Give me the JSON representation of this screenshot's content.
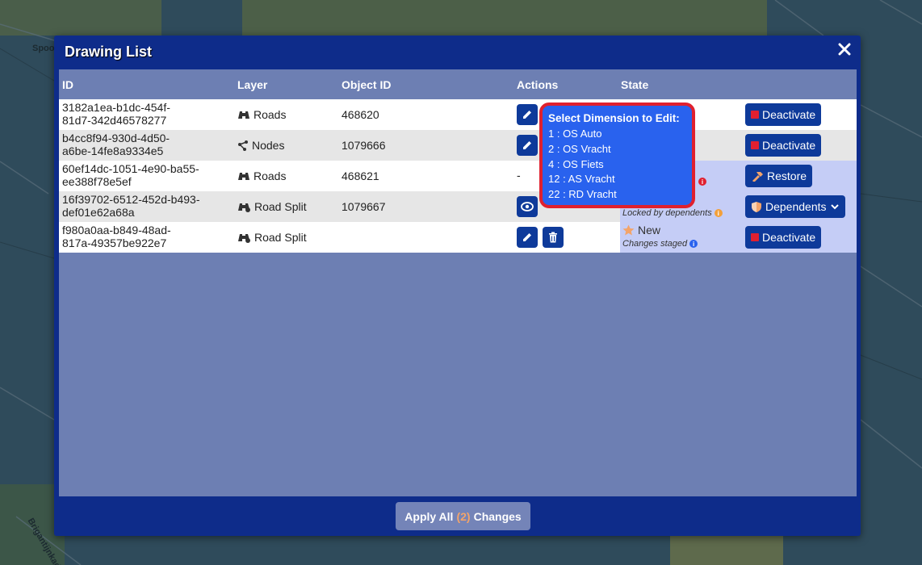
{
  "map": {
    "labels": [
      "Spoo",
      "Briganti...",
      "Brigantijnkade"
    ]
  },
  "dialog": {
    "title": "Drawing List",
    "close_icon": "close-icon"
  },
  "table": {
    "headers": {
      "id": "ID",
      "layer": "Layer",
      "object_id": "Object ID",
      "actions": "Actions",
      "state": "State"
    },
    "rows": [
      {
        "id_line1": "3182a1ea-b1dc-454f-",
        "id_line2": "81d7-342d46578277",
        "layer": "Roads",
        "layer_icon": "binoculars-icon",
        "object_id": "468620",
        "action_button": "Deactivate",
        "state_main": "",
        "state_sub": ""
      },
      {
        "id_line1": "b4cc8f94-930d-4d50-",
        "id_line2": "a6be-14fe8a9334e5",
        "layer": "Nodes",
        "layer_icon": "nodes-icon",
        "object_id": "1079666",
        "action_button": "Deactivate",
        "state_main": "",
        "state_sub": ""
      },
      {
        "id_line1": "60ef14dc-1051-4e90-ba55-",
        "id_line2": "ee388f78e5ef",
        "layer": "Roads",
        "layer_icon": "binoculars-icon",
        "object_id": "468621",
        "actions_text": "-",
        "action_button": "Restore",
        "state_main": "",
        "state_sub": ""
      },
      {
        "id_line1": "16f39702-6512-452d-b493-",
        "id_line2": "def01e62a68a",
        "layer": "Road Split",
        "layer_icon": "road-split-icon",
        "object_id": "1079667",
        "action_button": "Dependents",
        "state_main": "",
        "state_sub": "Locked by dependents"
      },
      {
        "id_line1": "f980a0aa-b849-48ad-",
        "id_line2": "817a-49357be922e7",
        "layer": "Road Split",
        "layer_icon": "road-split-icon",
        "object_id": "",
        "action_button": "Deactivate",
        "state_main": "New",
        "state_sub": "Changes staged"
      }
    ]
  },
  "tooltip": {
    "title": "Select Dimension to Edit:",
    "items": [
      "1 : OS Auto",
      "2 : OS Vracht",
      "4 : OS Fiets",
      "12 : AS Vracht",
      "22 : RD Vracht"
    ]
  },
  "footer": {
    "apply_prefix": "Apply All",
    "apply_count": "(2)",
    "apply_suffix": "Changes"
  },
  "colors": {
    "dialog_bg": "#0e2c8a",
    "panel_bg": "#6d7fb3",
    "button_bg": "#0e3a9a",
    "tooltip_bg": "#2962ee",
    "tooltip_border": "#e0202e",
    "deactivate_square": "#e02030",
    "apply_count": "#f3a46a"
  }
}
